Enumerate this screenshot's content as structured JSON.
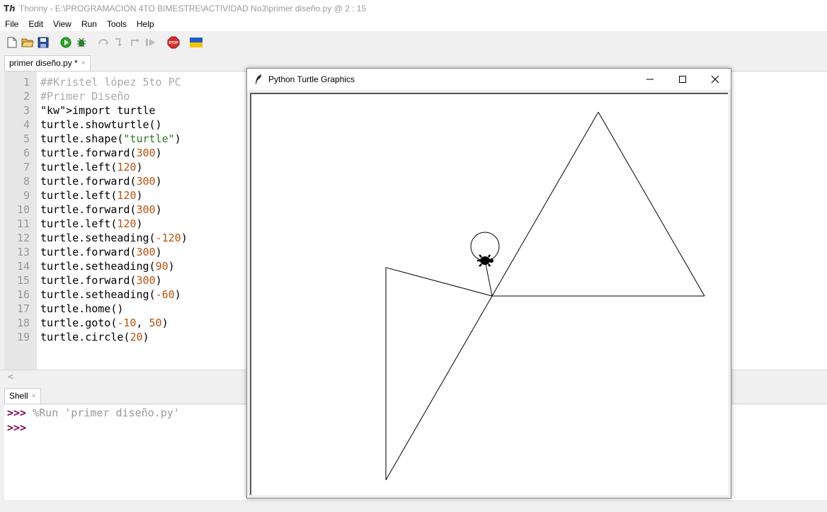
{
  "window": {
    "app_name": "Thonny",
    "title": "Thonny  -  E:\\PROGRAMACIÓN 4TO BIMESTRE\\ACTIVIDAD No3\\primer diseño.py  @  2 : 15"
  },
  "menu": [
    "File",
    "Edit",
    "View",
    "Run",
    "Tools",
    "Help"
  ],
  "toolbar": {
    "icons": [
      "new-file-icon",
      "open-file-icon",
      "save-icon",
      "run-icon",
      "debug-icon",
      "step-over-icon",
      "step-into-icon",
      "step-out-icon",
      "resume-icon",
      "stop-icon",
      "ukraine-flag-icon"
    ]
  },
  "editor": {
    "tab_label": "primer diseño.py *",
    "tab_close": "×",
    "line_numbers": [
      "1",
      "2",
      "3",
      "4",
      "5",
      "6",
      "7",
      "8",
      "9",
      "10",
      "11",
      "12",
      "13",
      "14",
      "15",
      "16",
      "17",
      "18",
      "19"
    ],
    "lines": [
      "##Kristel lópez 5to PC",
      "#Primer Diseño",
      "import turtle",
      "turtle.showturtle()",
      "turtle.shape(\"turtle\")",
      "turtle.forward(300)",
      "turtle.left(120)",
      "turtle.forward(300)",
      "turtle.left(120)",
      "turtle.forward(300)",
      "turtle.left(120)",
      "turtle.setheading(-120)",
      "turtle.forward(300)",
      "turtle.setheading(90)",
      "turtle.forward(300)",
      "turtle.setheading(-60)",
      "turtle.home()",
      "turtle.goto(-10, 50)",
      "turtle.circle(20)"
    ],
    "scroll_left": "<"
  },
  "shell": {
    "tab_label": "Shell",
    "tab_close": "×",
    "prompt": ">>>",
    "run_command": " %Run 'primer diseño.py'"
  },
  "turtle_window": {
    "title": "Python Turtle Graphics",
    "drawing": {
      "origin": [
        0,
        0
      ],
      "lines": [
        [
          [
            0,
            0
          ],
          [
            300,
            0
          ]
        ],
        [
          [
            300,
            0
          ],
          [
            150,
            259.8
          ]
        ],
        [
          [
            150,
            259.8
          ],
          [
            0,
            0
          ]
        ],
        [
          [
            0,
            0
          ],
          [
            -150,
            -259.8
          ]
        ],
        [
          [
            -150,
            -259.8
          ],
          [
            -150,
            40.2
          ]
        ],
        [
          [
            -150,
            40.2
          ],
          [
            0,
            0
          ]
        ],
        [
          [
            0,
            0
          ],
          [
            -10,
            50
          ]
        ]
      ],
      "circle": {
        "start": [
          -10,
          50
        ],
        "radius": 20
      },
      "turtle_position": [
        -10,
        50
      ]
    }
  },
  "colors": {
    "keyword": "#7f0055",
    "number": "#b5530f",
    "string": "#2c7a20",
    "comment": "#aaaaaa"
  }
}
